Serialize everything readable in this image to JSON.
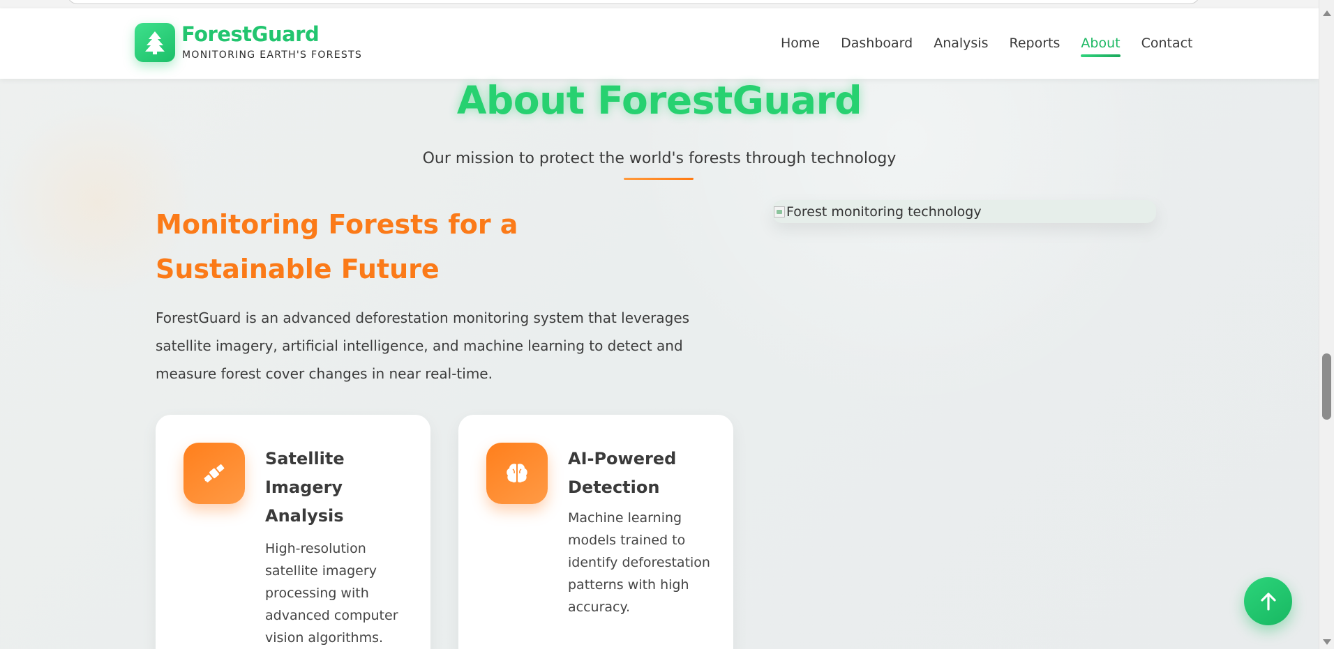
{
  "header": {
    "brand_name": "ForestGuard",
    "brand_tagline": "MONITORING EARTH'S FORESTS",
    "nav": [
      {
        "label": "Home",
        "active": false
      },
      {
        "label": "Dashboard",
        "active": false
      },
      {
        "label": "Analysis",
        "active": false
      },
      {
        "label": "Reports",
        "active": false
      },
      {
        "label": "About",
        "active": true
      },
      {
        "label": "Contact",
        "active": false
      }
    ]
  },
  "hero": {
    "title": "About ForestGuard",
    "subtitle": "Our mission to protect the world's forests through technology"
  },
  "intro": {
    "heading": "Monitoring Forests for a Sustainable Future",
    "paragraph": "ForestGuard is an advanced deforestation monitoring system that leverages satellite imagery, artificial intelligence, and machine learning to detect and measure forest cover changes in near real-time.",
    "image_alt": "Forest monitoring technology"
  },
  "features": [
    {
      "icon": "satellite-icon",
      "title": "Satellite Imagery Analysis",
      "description": "High-resolution satellite imagery processing with advanced computer vision algorithms."
    },
    {
      "icon": "brain-icon",
      "title": "AI-Powered Detection",
      "description": "Machine learning models trained to identify deforestation patterns with high accuracy."
    }
  ],
  "colors": {
    "brand_green": "#22c56f",
    "accent_orange": "#fb7a18",
    "text_dark": "#3a3a3a"
  },
  "icons": {
    "logo": "tree-icon",
    "scroll_top": "arrow-up-icon"
  }
}
